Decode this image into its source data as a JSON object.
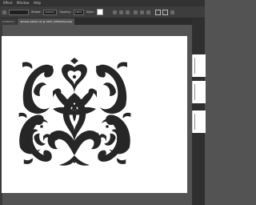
{
  "window": {
    "title": "Adobe Illustrator"
  },
  "menubar": {
    "items": [
      "Effect",
      "Window",
      "Help"
    ]
  },
  "options_bar": {
    "stroke_label": "Stroke:",
    "style_label": "Uniform",
    "opacity_label": "Opacity:",
    "opacity_value": "100%",
    "style_menu_label": "Style:"
  },
  "documents": {
    "tabs": [
      {
        "label": "Untitled-1"
      },
      {
        "label": "damask pattern.ai @ 100% (CMYK/Preview)"
      }
    ]
  },
  "artwork": {
    "pattern_name": "damask-ornament",
    "fill": "#262626",
    "background": "#ffffff"
  },
  "colors": {
    "app_bg": "#535353",
    "panel_bg": "#323232"
  }
}
